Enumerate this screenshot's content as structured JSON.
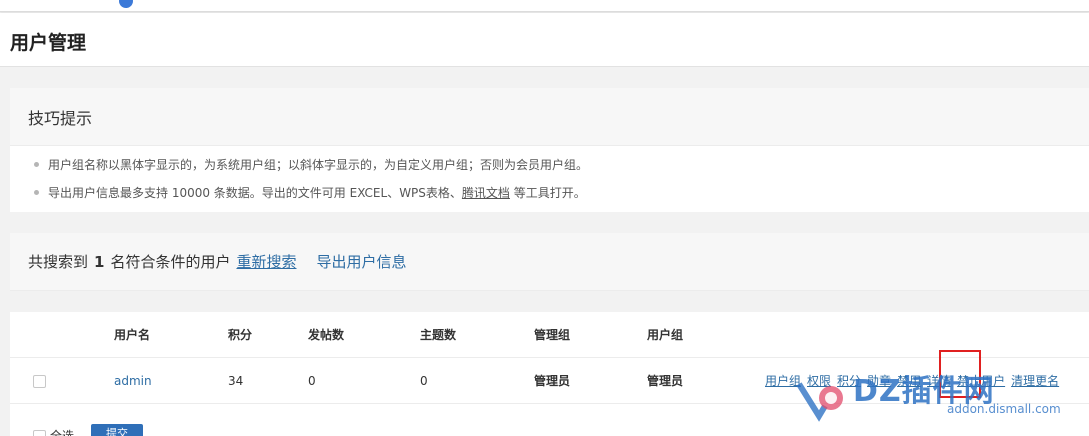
{
  "page": {
    "title": "用户管理"
  },
  "tips": {
    "title": "技巧提示",
    "line1": "用户组名称以黑体字显示的，为系统用户组；以斜体字显示的，为自定义用户组；否则为会员用户组。",
    "line2_before": "导出用户信息最多支持 10000 条数据。导出的文件可用 EXCEL、WPS表格、",
    "line2_link": "腾讯文档",
    "line2_after": " 等工具打开。"
  },
  "search": {
    "prefix": "共搜索到",
    "count": "1",
    "suffix": "名符合条件的用户",
    "research_link": "重新搜索",
    "export_link": "导出用户信息"
  },
  "table": {
    "headers": {
      "username": "用户名",
      "credits": "积分",
      "posts": "发帖数",
      "threads": "主题数",
      "admin_group": "管理组",
      "user_group": "用户组"
    },
    "rows": [
      {
        "username": "admin",
        "credits": "34",
        "posts": "0",
        "threads": "0",
        "admin_group": "管理员",
        "user_group": "管理员"
      }
    ],
    "ops": [
      "用户组",
      "权限",
      "积分",
      "勋章",
      "禁用",
      "详情",
      "禁止用户",
      "清理更名"
    ]
  },
  "footer": {
    "select_all": "全选",
    "submit": "提交"
  },
  "watermark": {
    "brand": "DZ插件网",
    "domain": "addon.dismall.com"
  },
  "colors": {
    "link": "#2e6da4",
    "primary_button": "#2f6fb8",
    "highlight": "#e02020"
  }
}
